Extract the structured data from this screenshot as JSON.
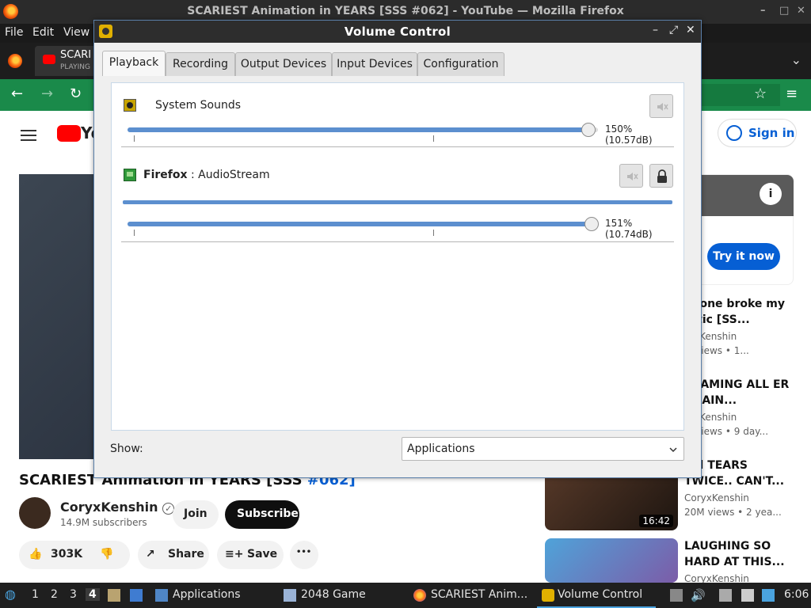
{
  "firefox": {
    "window_title": "SCARIEST Animation in YEARS [SSS #062] - YouTube — Mozilla Firefox",
    "menu": [
      "File",
      "Edit",
      "View"
    ],
    "tab": {
      "title": "SCARI",
      "sub": "PLAYING"
    }
  },
  "youtube": {
    "logo_partial": "Yo",
    "sign_in": "Sign in",
    "video_title": "SCARIEST Animation in YEARS [SSS ",
    "video_title_tag": "#062]",
    "channel": "CoryxKenshin",
    "verified": "✓",
    "subscribers": "14.9M subscribers",
    "join": "Join",
    "subscribe": "Subscribe",
    "likes": "303K",
    "share": "Share",
    "save": "Save",
    "more": "•••",
    "ad_button": "Try it now",
    "recommendations": [
      {
        "title": "neone broke my attic [SS...",
        "channel": "ryxKenshin",
        "meta": "M views • 1..."
      },
      {
        "title": "REAMING ALL ER AGAIN...",
        "channel": "ryxKenshin",
        "meta": "M views • 9 day..."
      },
      {
        "title": "ied TEARS TWICE.. CAN'T...",
        "channel": "CoryxKenshin",
        "meta": "20M views • 2 yea...",
        "duration": "16:42"
      },
      {
        "title": "LAUGHING SO HARD AT THIS...",
        "channel": "CoryxKenshin",
        "meta": ""
      }
    ]
  },
  "volume_control": {
    "title": "Volume Control",
    "controls": [
      "–",
      "⤢",
      "✕"
    ],
    "tabs": [
      "Playback",
      "Recording",
      "Output Devices",
      "Input Devices",
      "Configuration"
    ],
    "active_tab": "Playback",
    "streams": [
      {
        "app": "",
        "name": "System Sounds",
        "icon": "speaker-icon",
        "volume_pct": 150,
        "volume_label": "150% (10.57dB)"
      },
      {
        "app": "Firefox",
        "name": " : AudioStream",
        "icon": "sound-card-icon",
        "volume_pct": 151,
        "volume_label": "151% (10.74dB)",
        "peak": 1.0
      }
    ],
    "show_label": "Show:",
    "show_value": "Applications"
  },
  "taskbar": {
    "workspaces": [
      "1",
      "2",
      "3",
      "4"
    ],
    "active_workspace": "4",
    "tasks": [
      {
        "label": "Applications"
      },
      {
        "label": "2048 Game"
      },
      {
        "label": "SCARIEST Anim..."
      },
      {
        "label": "Volume Control",
        "active": true
      }
    ],
    "clock": "6:06"
  },
  "colors": {
    "accent": "#5c8fcf",
    "firefox_green": "#1a8a4a",
    "youtube_blue": "#065fd4"
  }
}
